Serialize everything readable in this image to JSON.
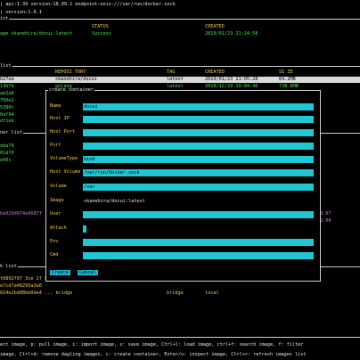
{
  "header": {
    "line1_prefix": "| api:1.39 version:18.09.1 endpoint:unix:///var/run/docker.sock",
    "line2_prefix": "| version:1.0.1",
    "panel_marker": "ist"
  },
  "tasks": {
    "col_status": "STATUS",
    "col_created": "CREATED",
    "row": {
      "name": "age skanehira/docui:latest",
      "status": "Success",
      "created": "2019/01/23 21:24:58"
    }
  },
  "images": {
    "panel_label": "list",
    "col_repository": "REPOSI TORY",
    "col_tag": "TAG",
    "col_created": "CREATED",
    "col_size": "SI ZE",
    "rows": [
      {
        "id": "b27ea",
        "repo": "skanehira/docui",
        "tag": "latest",
        "created": "2019/01/23 21:05:28",
        "size": "64.2MB"
      },
      {
        "id": "13b7b",
        "repo": "golang",
        "tag": "latest",
        "created": "2018/12/29 19:04:40",
        "size": "738.6MB"
      }
    ],
    "more_ids": [
      "ae2a8",
      "760e2",
      "5396t",
      "0af94",
      "df1eb"
    ]
  },
  "containers": {
    "panel_label": "ner list",
    "ids": [
      "dda79",
      "01df0",
      "e00c",
      "be029d974e0687f"
    ],
    "right_values": [
      "43.07",
      "22:00"
    ]
  },
  "networks": {
    "panel_label": "k list",
    "ids": [
      "t0892f07 3ce 2f 54",
      "e7cd7a48295a3a0",
      "824e2bd08bb0de4 ... bridge"
    ],
    "driver": "bridge",
    "scope": "local"
  },
  "dialog": {
    "title": "create container",
    "fields": [
      {
        "label": "Name",
        "value": "docui"
      },
      {
        "label": "Host IP",
        "value": ""
      },
      {
        "label": "Host Port",
        "value": ""
      },
      {
        "label": "Port",
        "value": ""
      },
      {
        "label": "VolumeType",
        "value": "bind"
      },
      {
        "label": "Host Volume",
        "value": "/var/run/docker.sock"
      },
      {
        "label": "Volume",
        "value": "/var"
      },
      {
        "label": "Image",
        "value": "skanehira/docui:latest"
      },
      {
        "label": "User",
        "value": ""
      },
      {
        "label": "Attach",
        "value": ""
      },
      {
        "label": "Env",
        "value": ""
      },
      {
        "label": "Cmd",
        "value": ""
      }
    ],
    "create_label": "Create",
    "cancel_label": "Cancel"
  },
  "footer": {
    "line1": "ect image, p: pull image, i: import image, s: save image, Ctrl+l: load image, ctrl+f: search image, f: filter",
    "line2": "image, Ctrl+d: remove dagling images, c: create container, Enter/o: inspect image, Ctrl+r: refresh images list"
  },
  "colors": {
    "accent": "#22c7d4",
    "label": "#f2c94c",
    "status_ok": "#52e052",
    "value": "#c77ad8"
  }
}
